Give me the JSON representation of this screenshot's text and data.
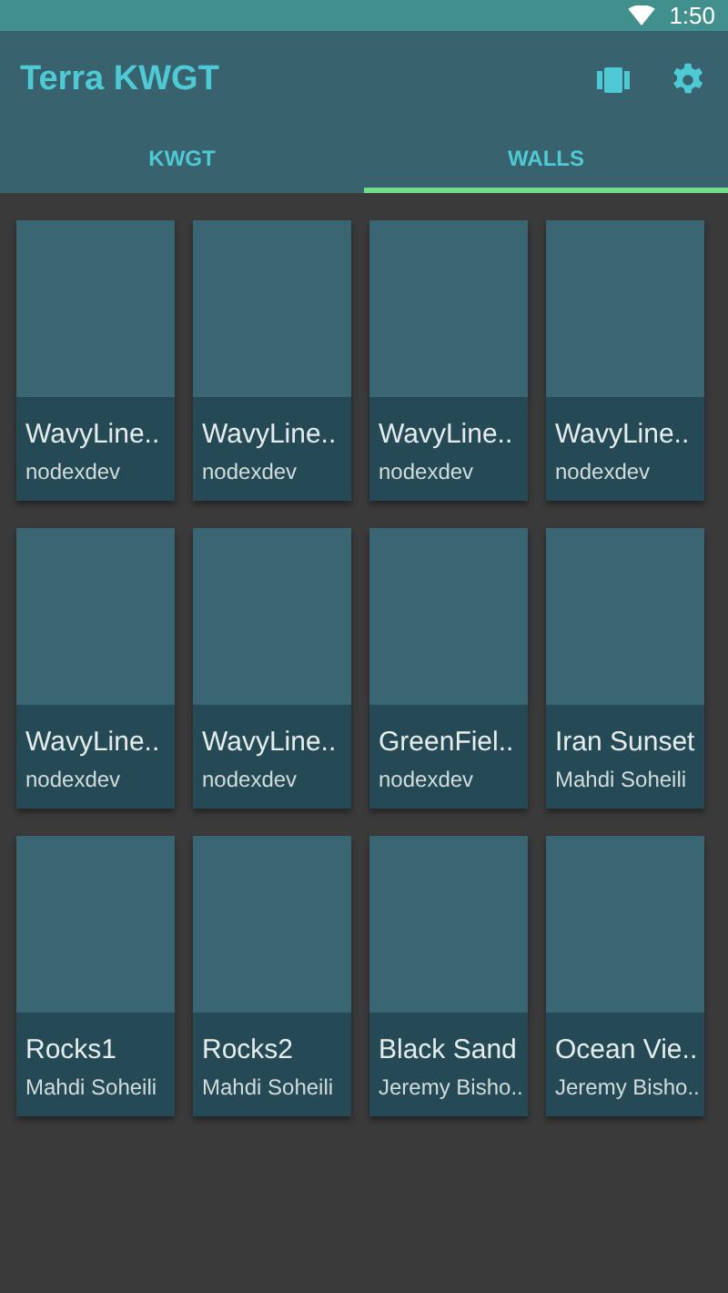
{
  "status_bar": {
    "time": "1:50"
  },
  "app_bar": {
    "title": "Terra KWGT"
  },
  "tabs": [
    {
      "label": "KWGT",
      "selected": false
    },
    {
      "label": "WALLS",
      "selected": true
    }
  ],
  "walls": [
    {
      "name": "WavyLine..",
      "author": "nodexdev"
    },
    {
      "name": "WavyLine..",
      "author": "nodexdev"
    },
    {
      "name": "WavyLine..",
      "author": "nodexdev"
    },
    {
      "name": "WavyLine..",
      "author": "nodexdev"
    },
    {
      "name": "WavyLine..",
      "author": "nodexdev"
    },
    {
      "name": "WavyLine..",
      "author": "nodexdev"
    },
    {
      "name": "GreenFiel..",
      "author": "nodexdev"
    },
    {
      "name": "Iran Sunset",
      "author": "Mahdi Soheili"
    },
    {
      "name": "Rocks1",
      "author": "Mahdi Soheili"
    },
    {
      "name": "Rocks2",
      "author": "Mahdi Soheili"
    },
    {
      "name": "Black Sand",
      "author": "Jeremy Bisho.."
    },
    {
      "name": "Ocean Vie..",
      "author": "Jeremy Bisho.."
    }
  ]
}
